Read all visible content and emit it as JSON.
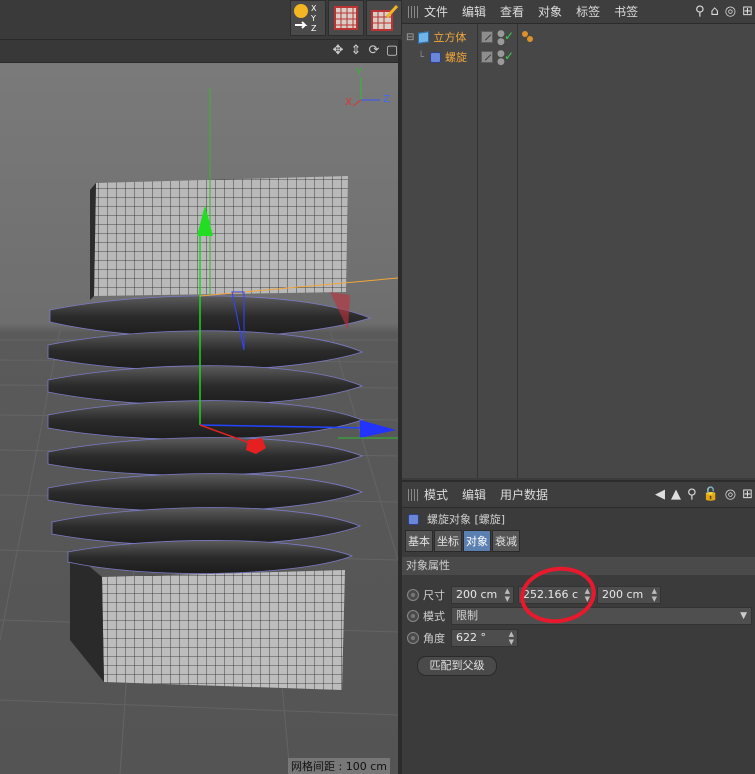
{
  "object_manager": {
    "menu": [
      "文件",
      "编辑",
      "查看",
      "对象",
      "标签",
      "书签"
    ],
    "objects": [
      {
        "name": "立方体",
        "highlighted": true
      },
      {
        "name": "螺旋",
        "highlighted": true
      }
    ]
  },
  "attribute_manager": {
    "menu": [
      "模式",
      "编辑",
      "用户数据"
    ],
    "title": "螺旋对象 [螺旋]",
    "tabs": [
      "基本",
      "坐标",
      "对象",
      "衰减"
    ],
    "active_tab": "对象",
    "section": "对象属性",
    "size": {
      "label": "尺寸",
      "x": "200 cm",
      "y": "252.166 c",
      "z": "200 cm"
    },
    "mode": {
      "label": "模式",
      "value": "限制"
    },
    "angle": {
      "label": "角度",
      "value": "622 °"
    },
    "match_button": "匹配到父级"
  },
  "viewport": {
    "grid_spacing": "网格间距 : 100 cm",
    "axis_labels": {
      "y": "Y",
      "x": "X",
      "z": "Z"
    }
  },
  "colors": {
    "accent": "#5c7fb2",
    "highlight": "#f2a63a",
    "annotation": "#e8192c"
  }
}
